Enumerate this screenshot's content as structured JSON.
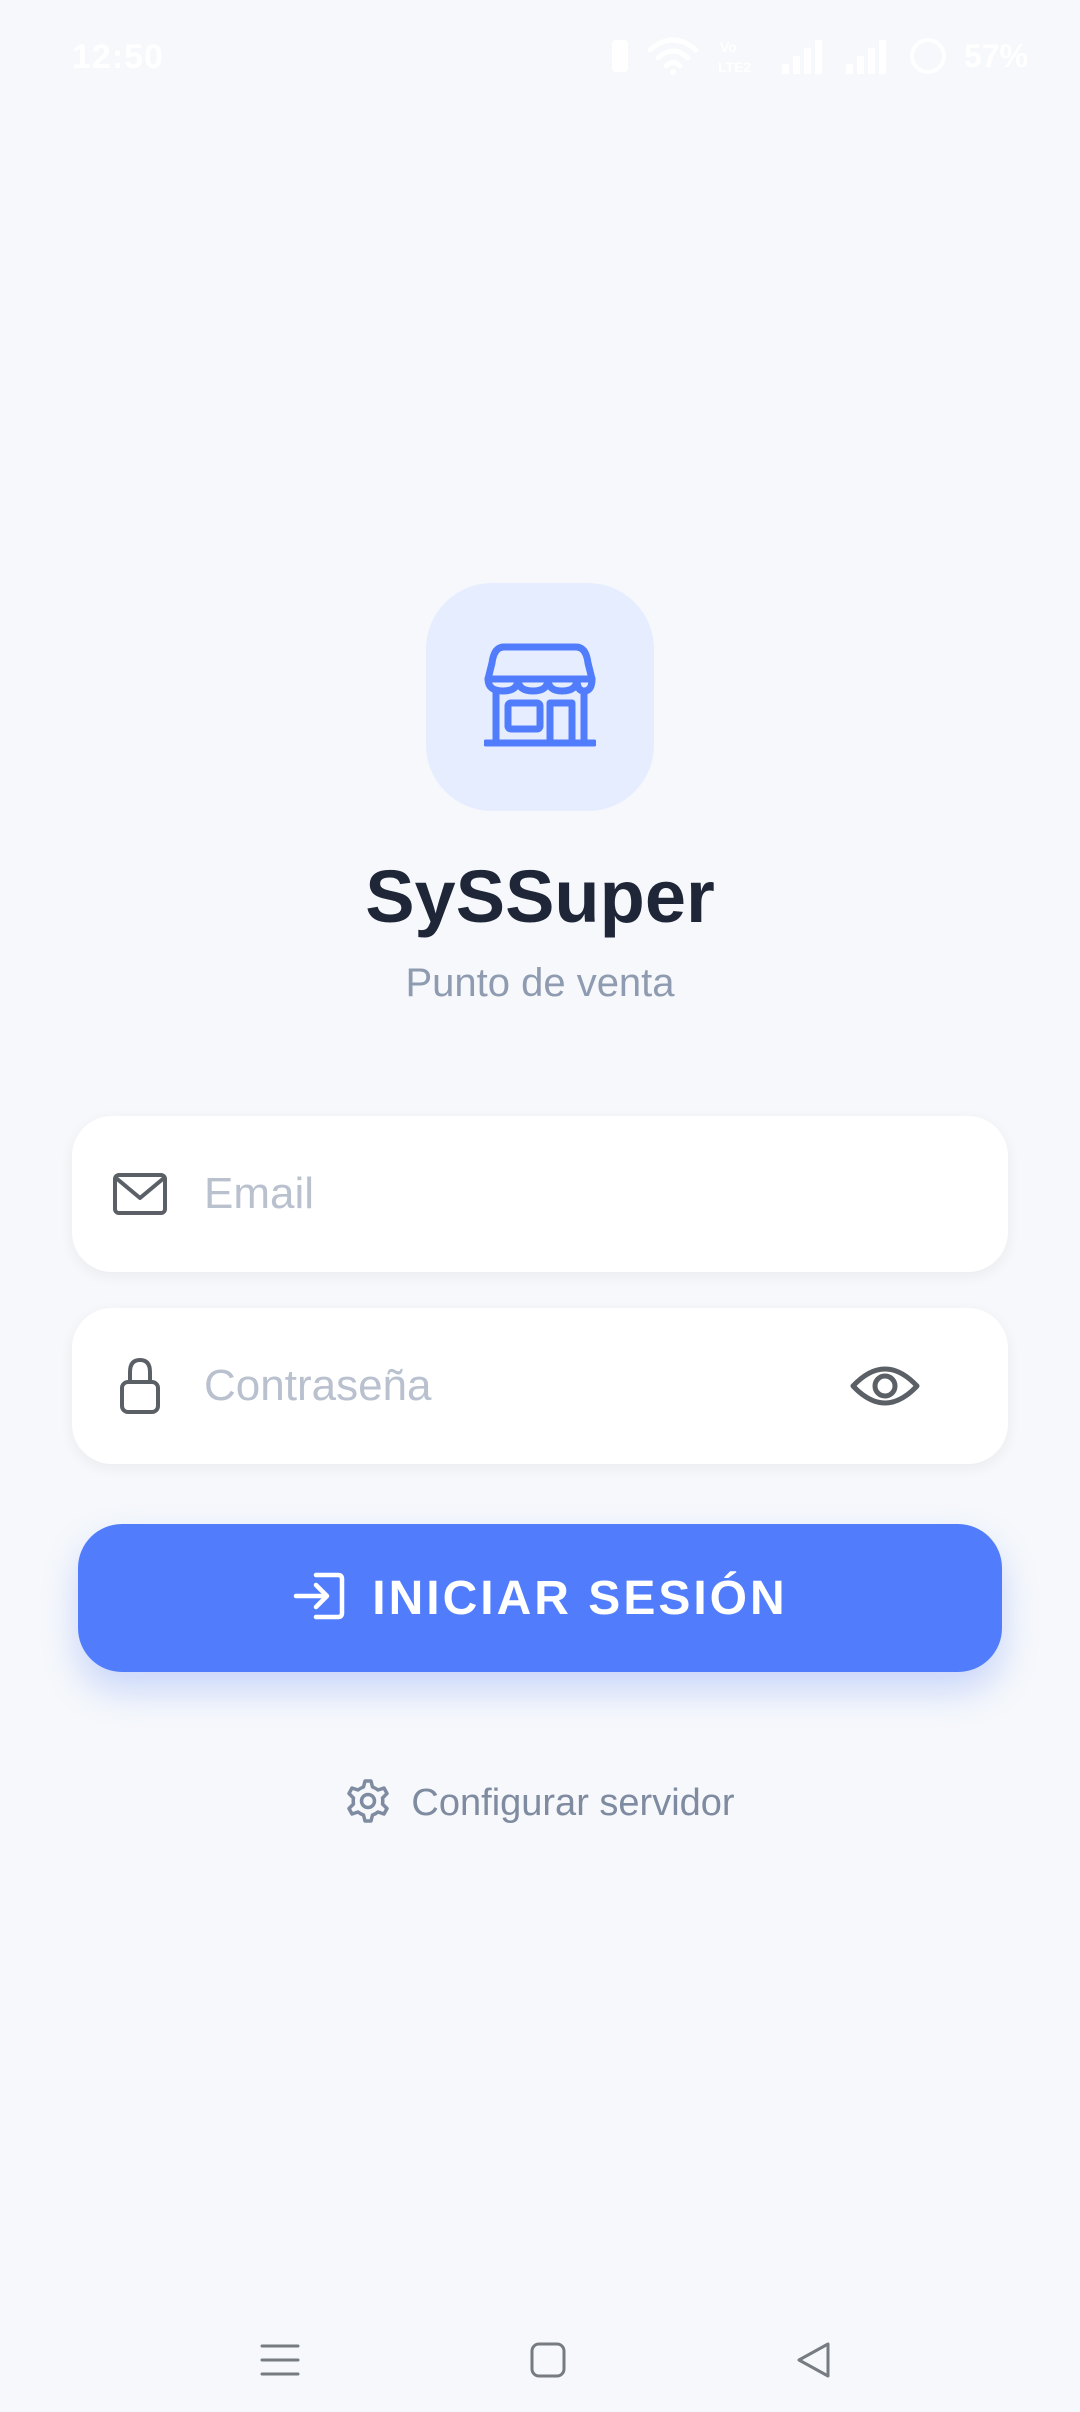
{
  "status_bar": {
    "time": "12:50",
    "battery_percent": "57%",
    "icons": [
      "battery-saver-icon",
      "wifi-icon",
      "volte-icon",
      "signal-1-icon",
      "signal-2-icon",
      "battery-ring-icon"
    ]
  },
  "app": {
    "logo_icon": "storefront-icon",
    "name": "SySSuper",
    "subtitle": "Punto de venta"
  },
  "form": {
    "email": {
      "icon": "envelope-icon",
      "placeholder": "Email",
      "value": ""
    },
    "password": {
      "icon": "lock-icon",
      "placeholder": "Contraseña",
      "value": "",
      "toggle_icon": "eye-icon"
    },
    "login_button": {
      "icon": "login-arrow-icon",
      "label": "INICIAR SESIÓN"
    },
    "config_link": {
      "icon": "gear-icon",
      "label": "Configurar servidor"
    }
  },
  "nav_bar": {
    "buttons": [
      "menu-icon",
      "home-square-icon",
      "back-triangle-icon"
    ]
  },
  "colors": {
    "background": "#f6f8fb",
    "primary": "#517dfd",
    "logo_tile": "#e6edff",
    "title": "#1e2638",
    "muted": "#8f9bb0"
  }
}
